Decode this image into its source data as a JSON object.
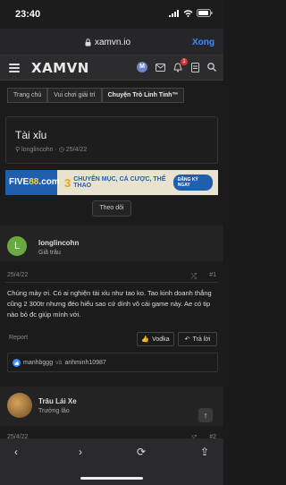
{
  "status": {
    "time": "23:40"
  },
  "browser": {
    "url": "xamvn.io",
    "done_label": "Xong"
  },
  "header": {
    "logo": "XAMVN",
    "avatar_letter": "M",
    "alerts_badge": "1"
  },
  "breadcrumb": [
    "Trang chủ",
    "Vui chơi giải trí",
    "Chuyện Trò Linh Tinh™"
  ],
  "thread": {
    "title": "Tài xỉu",
    "author": "longlincohn",
    "date": "25/4/22"
  },
  "banner": {
    "brand_a": "FIVE",
    "brand_b": "88",
    "brand_c": ".com",
    "number": "3",
    "text": "CHUYÊN MỤC, CÁ CƯỢC, THỂ THAO",
    "cta": "ĐĂNG KÝ NGAY"
  },
  "follow_label": "Theo dõi",
  "post1": {
    "avatar_letter": "L",
    "user": "longlincohn",
    "rank": "Giã trâu",
    "date": "25/4/22",
    "number": "#1",
    "body": "Chúng mày ơi. Có ai nghiện tài xỉu như tao ko. Tao kinh doanh thắng cũng 2 300tr nhưng đéo hiểu sao cứ dính vô cái game này. Ae có tip nào bỏ đc giúp mình với.",
    "report": "Report",
    "react_label": "Vodka",
    "reply_label": "Trả lời",
    "likes_user1": "manhbggg",
    "likes_and": "và",
    "likes_user2": "anhminh10987"
  },
  "post2": {
    "user": "Trâu Lái Xe",
    "rank": "Trưởng lão",
    "date": "25/4/22",
    "number": "#2"
  },
  "colors": {
    "accent": "#3f8cff",
    "banner_blue": "#1f5fae",
    "banner_orange": "#f2a20c",
    "user1_avatar": "#6aa842"
  }
}
